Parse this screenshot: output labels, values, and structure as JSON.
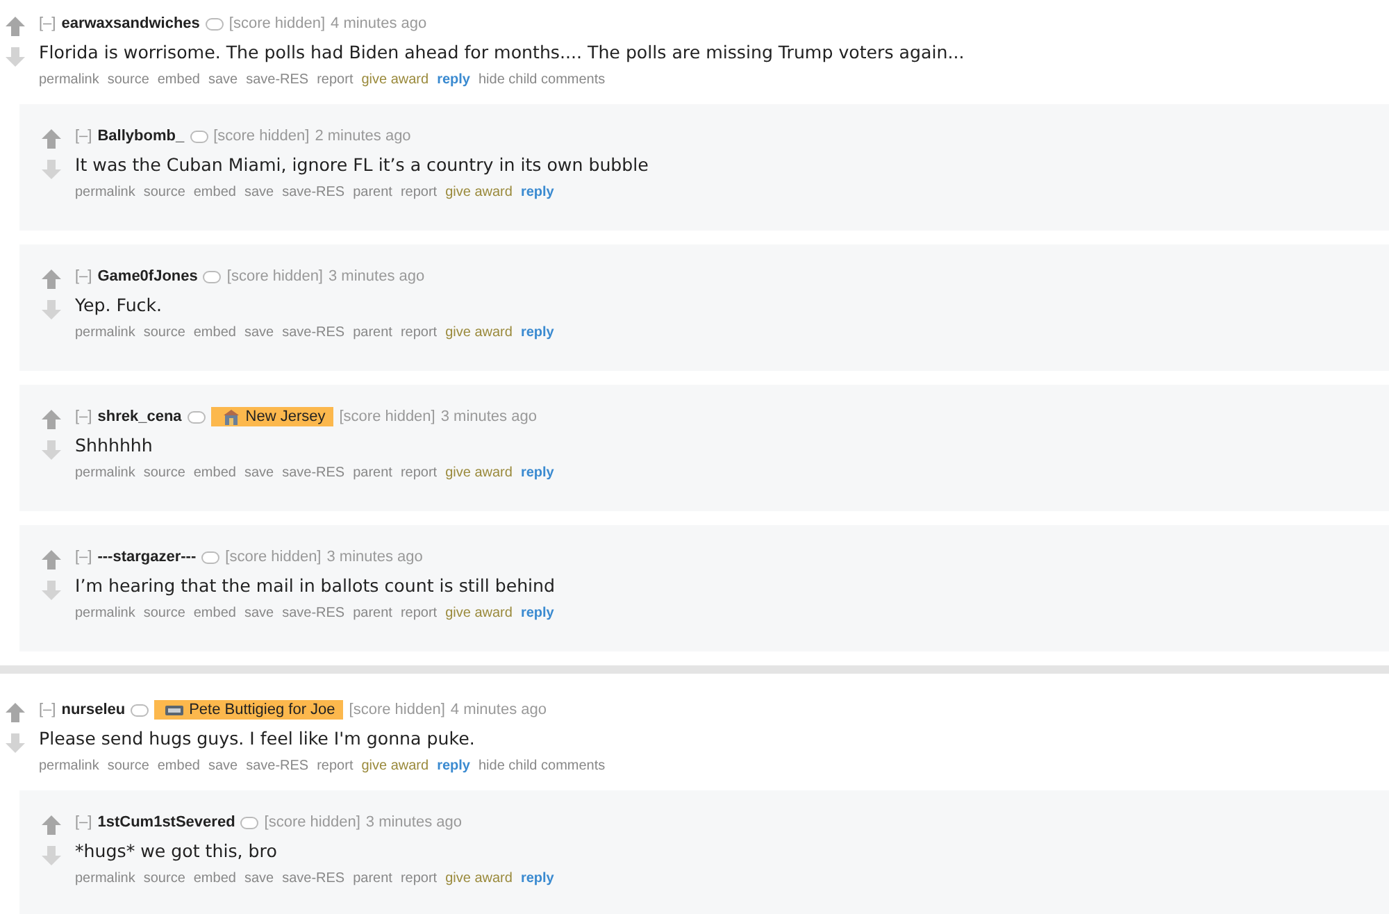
{
  "threads": [
    {
      "collapse": "[–]",
      "author": "earwaxsandwiches",
      "score": "[score hidden]",
      "time": "4 minutes ago",
      "body": "Florida is worrisome. The polls had Biden ahead for months.... The polls are missing Trump voters again...",
      "actions": [
        {
          "label": "permalink",
          "kind": "plain"
        },
        {
          "label": "source",
          "kind": "plain"
        },
        {
          "label": "embed",
          "kind": "plain"
        },
        {
          "label": "save",
          "kind": "plain"
        },
        {
          "label": "save-RES",
          "kind": "plain"
        },
        {
          "label": "report",
          "kind": "plain"
        },
        {
          "label": "give award",
          "kind": "award"
        },
        {
          "label": "reply",
          "kind": "reply"
        },
        {
          "label": "hide child comments",
          "kind": "plain"
        }
      ],
      "children": [
        {
          "collapse": "[–]",
          "author": "Ballybomb_",
          "score": "[score hidden]",
          "time": "2 minutes ago",
          "body": "It was the Cuban Miami, ignore FL it’s a country in its own bubble",
          "actions": [
            {
              "label": "permalink",
              "kind": "plain"
            },
            {
              "label": "source",
              "kind": "plain"
            },
            {
              "label": "embed",
              "kind": "plain"
            },
            {
              "label": "save",
              "kind": "plain"
            },
            {
              "label": "save-RES",
              "kind": "plain"
            },
            {
              "label": "parent",
              "kind": "plain"
            },
            {
              "label": "report",
              "kind": "plain"
            },
            {
              "label": "give award",
              "kind": "award"
            },
            {
              "label": "reply",
              "kind": "reply"
            }
          ]
        },
        {
          "collapse": "[–]",
          "author": "Game0fJones",
          "score": "[score hidden]",
          "time": "3 minutes ago",
          "body": "Yep. Fuck.",
          "actions": [
            {
              "label": "permalink",
              "kind": "plain"
            },
            {
              "label": "source",
              "kind": "plain"
            },
            {
              "label": "embed",
              "kind": "plain"
            },
            {
              "label": "save",
              "kind": "plain"
            },
            {
              "label": "save-RES",
              "kind": "plain"
            },
            {
              "label": "parent",
              "kind": "plain"
            },
            {
              "label": "report",
              "kind": "plain"
            },
            {
              "label": "give award",
              "kind": "award"
            },
            {
              "label": "reply",
              "kind": "reply"
            }
          ]
        },
        {
          "collapse": "[–]",
          "author": "shrek_cena",
          "flair": {
            "text": "New Jersey",
            "kind": "building"
          },
          "score": "[score hidden]",
          "time": "3 minutes ago",
          "body": "Shhhhhh",
          "actions": [
            {
              "label": "permalink",
              "kind": "plain"
            },
            {
              "label": "source",
              "kind": "plain"
            },
            {
              "label": "embed",
              "kind": "plain"
            },
            {
              "label": "save",
              "kind": "plain"
            },
            {
              "label": "save-RES",
              "kind": "plain"
            },
            {
              "label": "parent",
              "kind": "plain"
            },
            {
              "label": "report",
              "kind": "plain"
            },
            {
              "label": "give award",
              "kind": "award"
            },
            {
              "label": "reply",
              "kind": "reply"
            }
          ]
        },
        {
          "collapse": "[–]",
          "author": "---stargazer---",
          "score": "[score hidden]",
          "time": "3 minutes ago",
          "body": "I’m hearing that the mail in ballots count is still behind",
          "actions": [
            {
              "label": "permalink",
              "kind": "plain"
            },
            {
              "label": "source",
              "kind": "plain"
            },
            {
              "label": "embed",
              "kind": "plain"
            },
            {
              "label": "save",
              "kind": "plain"
            },
            {
              "label": "save-RES",
              "kind": "plain"
            },
            {
              "label": "parent",
              "kind": "plain"
            },
            {
              "label": "report",
              "kind": "plain"
            },
            {
              "label": "give award",
              "kind": "award"
            },
            {
              "label": "reply",
              "kind": "reply"
            }
          ]
        }
      ]
    },
    {
      "collapse": "[–]",
      "author": "nurseleu",
      "flair": {
        "text": "Pete Buttigieg for Joe",
        "kind": "sign"
      },
      "score": "[score hidden]",
      "time": "4 minutes ago",
      "body": "Please send hugs guys. I feel like I'm gonna puke.",
      "actions": [
        {
          "label": "permalink",
          "kind": "plain"
        },
        {
          "label": "source",
          "kind": "plain"
        },
        {
          "label": "embed",
          "kind": "plain"
        },
        {
          "label": "save",
          "kind": "plain"
        },
        {
          "label": "save-RES",
          "kind": "plain"
        },
        {
          "label": "report",
          "kind": "plain"
        },
        {
          "label": "give award",
          "kind": "award"
        },
        {
          "label": "reply",
          "kind": "reply"
        },
        {
          "label": "hide child comments",
          "kind": "plain"
        }
      ],
      "children": [
        {
          "collapse": "[–]",
          "author": "1stCum1stSevered",
          "score": "[score hidden]",
          "time": "3 minutes ago",
          "body": "*hugs* we got this, bro",
          "actions": [
            {
              "label": "permalink",
              "kind": "plain"
            },
            {
              "label": "source",
              "kind": "plain"
            },
            {
              "label": "embed",
              "kind": "plain"
            },
            {
              "label": "save",
              "kind": "plain"
            },
            {
              "label": "save-RES",
              "kind": "plain"
            },
            {
              "label": "parent",
              "kind": "plain"
            },
            {
              "label": "report",
              "kind": "plain"
            },
            {
              "label": "give award",
              "kind": "award"
            },
            {
              "label": "reply",
              "kind": "reply"
            }
          ]
        }
      ]
    }
  ]
}
